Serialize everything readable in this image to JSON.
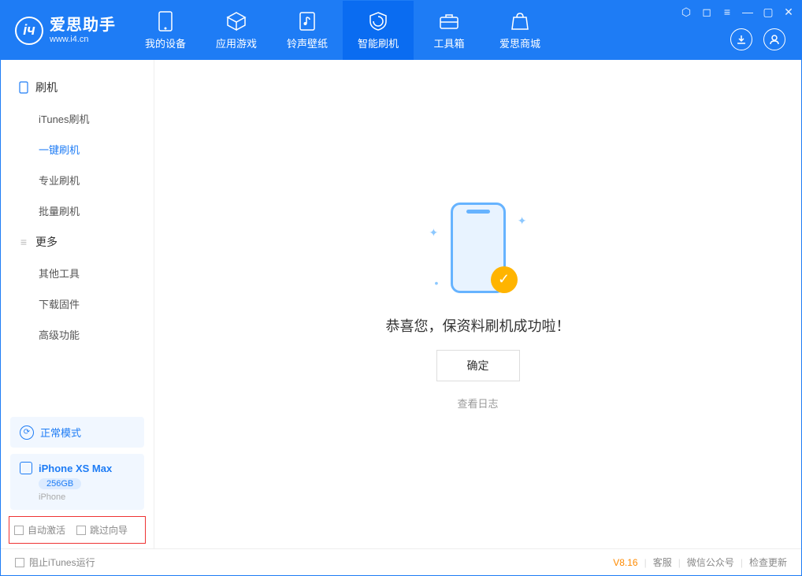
{
  "app": {
    "title": "爱思助手",
    "subtitle": "www.i4.cn"
  },
  "nav": {
    "tabs": [
      {
        "label": "我的设备"
      },
      {
        "label": "应用游戏"
      },
      {
        "label": "铃声壁纸"
      },
      {
        "label": "智能刷机"
      },
      {
        "label": "工具箱"
      },
      {
        "label": "爱思商城"
      }
    ]
  },
  "sidebar": {
    "section1": {
      "title": "刷机",
      "items": [
        "iTunes刷机",
        "一键刷机",
        "专业刷机",
        "批量刷机"
      ]
    },
    "section2": {
      "title": "更多",
      "items": [
        "其他工具",
        "下载固件",
        "高级功能"
      ]
    },
    "mode": "正常模式",
    "device": {
      "name": "iPhone XS Max",
      "storage": "256GB",
      "type": "iPhone"
    },
    "options": {
      "opt1": "自动激活",
      "opt2": "跳过向导"
    }
  },
  "main": {
    "message": "恭喜您，保资料刷机成功啦！",
    "ok": "确定",
    "log": "查看日志"
  },
  "footer": {
    "block_itunes": "阻止iTunes运行",
    "version": "V8.16",
    "links": [
      "客服",
      "微信公众号",
      "检查更新"
    ]
  }
}
